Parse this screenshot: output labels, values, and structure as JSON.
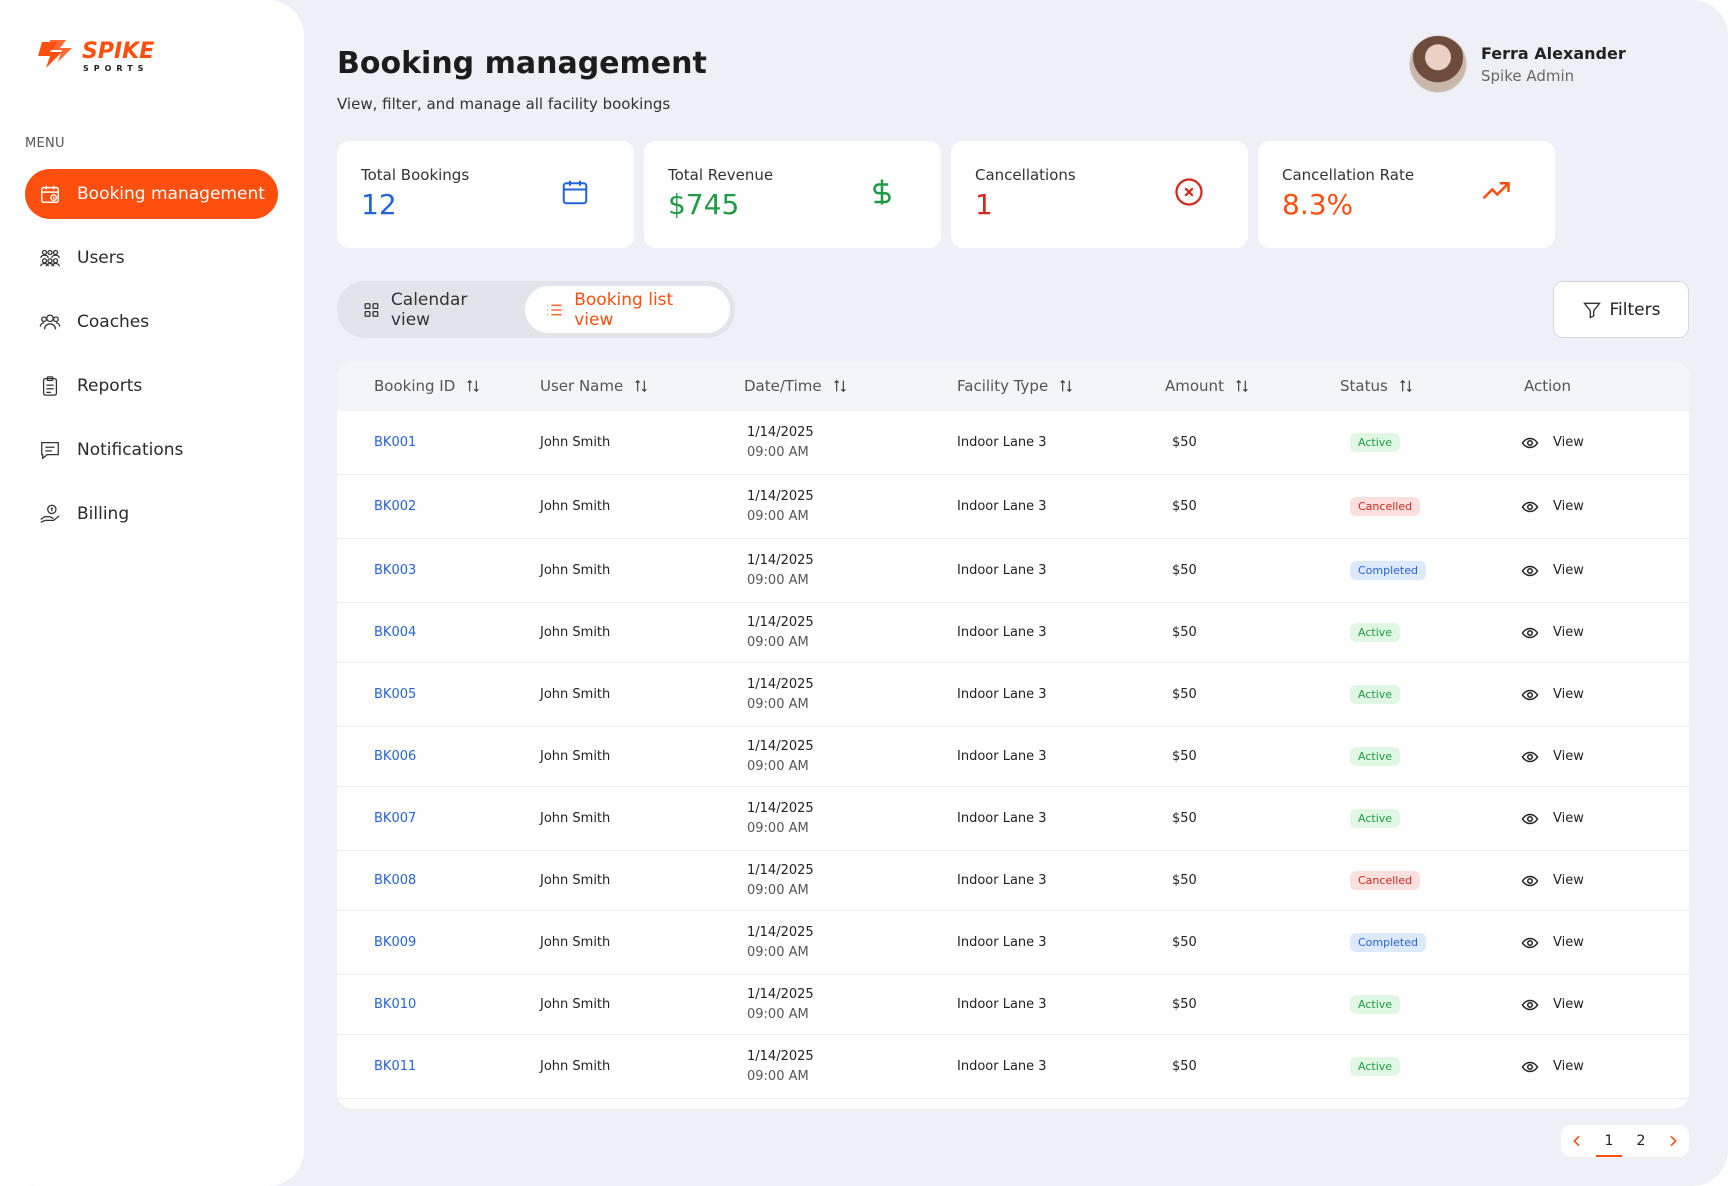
{
  "brand": {
    "name": "SPIKE",
    "tagline": "SPORTS",
    "color": "#ff4f0f"
  },
  "sidebar": {
    "menu_title": "MENU",
    "items": [
      {
        "label": "Booking management",
        "icon": "calendar-icon",
        "active": true
      },
      {
        "label": "Users",
        "icon": "users-icon"
      },
      {
        "label": "Coaches",
        "icon": "coaches-icon"
      },
      {
        "label": "Reports",
        "icon": "clipboard-icon"
      },
      {
        "label": "Notifications",
        "icon": "message-icon"
      },
      {
        "label": "Billing",
        "icon": "billing-icon"
      }
    ]
  },
  "header": {
    "title": "Booking management",
    "subtitle": "View, filter, and manage all facility bookings"
  },
  "user": {
    "name": "Ferra Alexander",
    "role": "Spike Admin"
  },
  "stats": [
    {
      "label": "Total Bookings",
      "value": "12",
      "color": "#2563d8",
      "icon": "calendar-icon"
    },
    {
      "label": "Total Revenue",
      "value": "$745",
      "color": "#1f9b45",
      "icon": "dollar-icon"
    },
    {
      "label": "Cancellations",
      "value": "1",
      "color": "#d22a1e",
      "icon": "cancel-circle-icon"
    },
    {
      "label": "Cancellation Rate",
      "value": "8.3%",
      "color": "#ff4f0f",
      "icon": "trend-up-icon"
    }
  ],
  "view_toggle": {
    "calendar_label": "Calendar view",
    "list_label": "Booking list view",
    "selected": "list"
  },
  "filters_label": "Filters",
  "table": {
    "columns": [
      "Booking ID",
      "User Name",
      "Date/Time",
      "Facility Type",
      "Amount",
      "Status",
      "Action"
    ],
    "rows": [
      {
        "id": "BK001",
        "user": "John Smith",
        "date": "1/14/2025",
        "time": "09:00 AM",
        "facility": "Indoor Lane 3",
        "amount": "$50",
        "status": "Active",
        "action": "View"
      },
      {
        "id": "BK002",
        "user": "John Smith",
        "date": "1/14/2025",
        "time": "09:00 AM",
        "facility": "Indoor Lane 3",
        "amount": "$50",
        "status": "Cancelled",
        "action": "View"
      },
      {
        "id": "BK003",
        "user": "John Smith",
        "date": "1/14/2025",
        "time": "09:00 AM",
        "facility": "Indoor Lane 3",
        "amount": "$50",
        "status": "Completed",
        "action": "View"
      },
      {
        "id": "BK004",
        "user": "John Smith",
        "date": "1/14/2025",
        "time": "09:00 AM",
        "facility": "Indoor Lane 3",
        "amount": "$50",
        "status": "Active",
        "action": "View"
      },
      {
        "id": "BK005",
        "user": "John Smith",
        "date": "1/14/2025",
        "time": "09:00 AM",
        "facility": "Indoor Lane 3",
        "amount": "$50",
        "status": "Active",
        "action": "View"
      },
      {
        "id": "BK006",
        "user": "John Smith",
        "date": "1/14/2025",
        "time": "09:00 AM",
        "facility": "Indoor Lane 3",
        "amount": "$50",
        "status": "Active",
        "action": "View"
      },
      {
        "id": "BK007",
        "user": "John Smith",
        "date": "1/14/2025",
        "time": "09:00 AM",
        "facility": "Indoor Lane 3",
        "amount": "$50",
        "status": "Active",
        "action": "View"
      },
      {
        "id": "BK008",
        "user": "John Smith",
        "date": "1/14/2025",
        "time": "09:00 AM",
        "facility": "Indoor Lane 3",
        "amount": "$50",
        "status": "Cancelled",
        "action": "View"
      },
      {
        "id": "BK009",
        "user": "John Smith",
        "date": "1/14/2025",
        "time": "09:00 AM",
        "facility": "Indoor Lane 3",
        "amount": "$50",
        "status": "Completed",
        "action": "View"
      },
      {
        "id": "BK010",
        "user": "John Smith",
        "date": "1/14/2025",
        "time": "09:00 AM",
        "facility": "Indoor Lane 3",
        "amount": "$50",
        "status": "Active",
        "action": "View"
      },
      {
        "id": "BK011",
        "user": "John Smith",
        "date": "1/14/2025",
        "time": "09:00 AM",
        "facility": "Indoor Lane 3",
        "amount": "$50",
        "status": "Active",
        "action": "View"
      }
    ]
  },
  "pagination": {
    "pages": [
      "1",
      "2"
    ],
    "current": "1"
  }
}
